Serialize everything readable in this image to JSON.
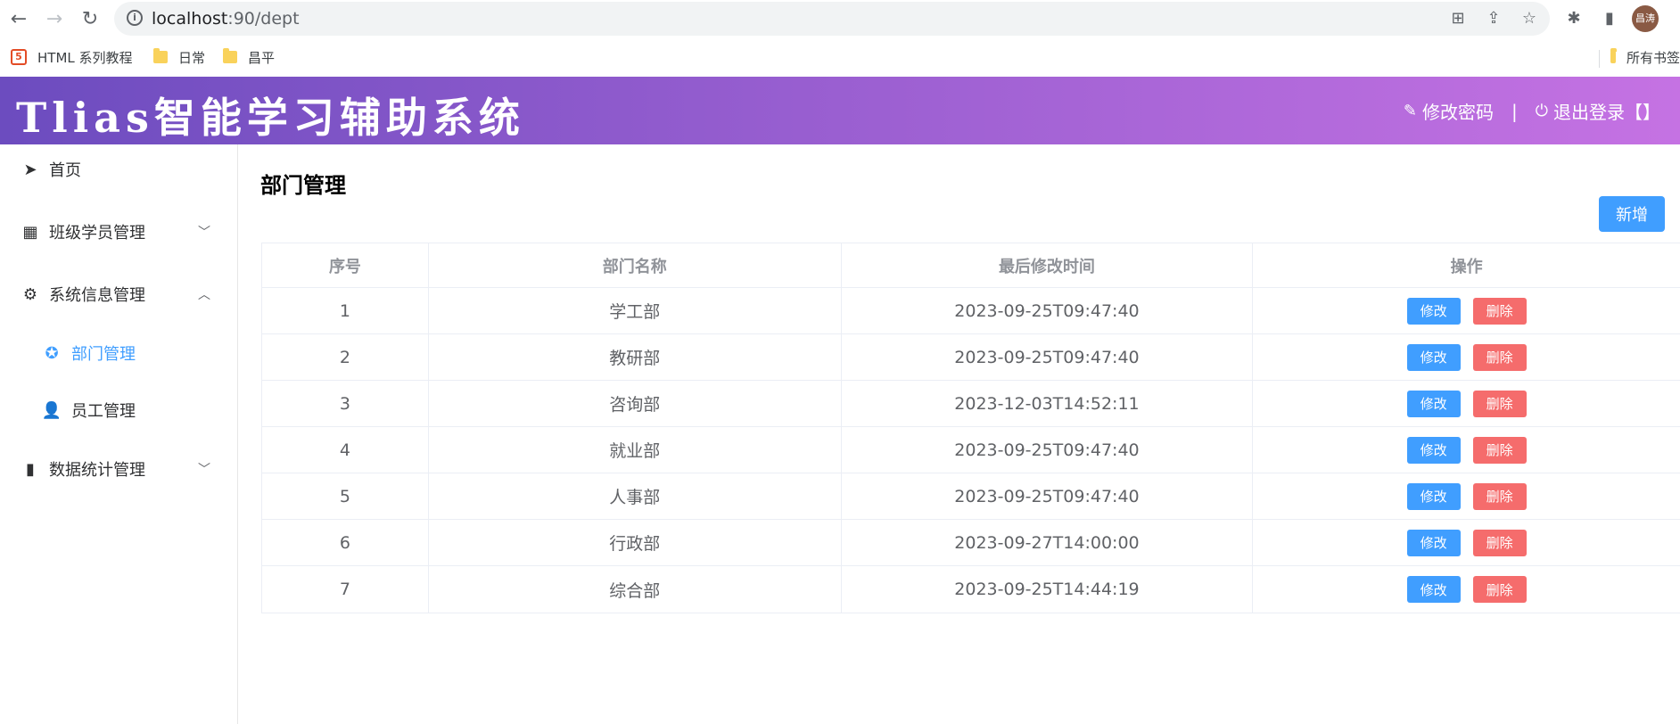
{
  "browser": {
    "url_host": "localhost",
    "url_path": ":90/dept",
    "profile_initials": "昌涛",
    "bookmarks": [
      {
        "label": "HTML 系列教程",
        "icon": "html-logo-icon"
      },
      {
        "label": "日常",
        "icon": "folder-icon"
      },
      {
        "label": "昌平",
        "icon": "folder-icon"
      }
    ],
    "all_bookmarks_label": "所有书签"
  },
  "header": {
    "title": "Tlias智能学习辅助系统",
    "change_password": "修改密码",
    "divider": "|",
    "logout": "退出登录【】"
  },
  "sidebar": {
    "items": [
      {
        "label": "首页",
        "icon": "paper-plane-icon"
      },
      {
        "label": "班级学员管理",
        "icon": "grid-icon",
        "chevron": "﹀"
      },
      {
        "label": "系统信息管理",
        "icon": "gear-icon",
        "chevron": "︿"
      },
      {
        "label": "部门管理",
        "icon": "compass-icon"
      },
      {
        "label": "员工管理",
        "icon": "user-icon"
      },
      {
        "label": "数据统计管理",
        "icon": "bar-chart-icon",
        "chevron": "﹀"
      }
    ]
  },
  "main": {
    "title": "部门管理",
    "add_button": "新增",
    "table": {
      "headers": [
        "序号",
        "部门名称",
        "最后修改时间",
        "操作"
      ],
      "edit_label": "修改",
      "delete_label": "删除",
      "rows": [
        {
          "index": "1",
          "name": "学工部",
          "updated": "2023-09-25T09:47:40"
        },
        {
          "index": "2",
          "name": "教研部",
          "updated": "2023-09-25T09:47:40"
        },
        {
          "index": "3",
          "name": "咨询部",
          "updated": "2023-12-03T14:52:11"
        },
        {
          "index": "4",
          "name": "就业部",
          "updated": "2023-09-25T09:47:40"
        },
        {
          "index": "5",
          "name": "人事部",
          "updated": "2023-09-25T09:47:40"
        },
        {
          "index": "6",
          "name": "行政部",
          "updated": "2023-09-27T14:00:00"
        },
        {
          "index": "7",
          "name": "综合部",
          "updated": "2023-09-25T14:44:19"
        }
      ]
    }
  },
  "colors": {
    "primary": "#409eff",
    "danger": "#f56c6c",
    "header_gradient_start": "#6c4cbf",
    "header_gradient_end": "#c572e3"
  }
}
